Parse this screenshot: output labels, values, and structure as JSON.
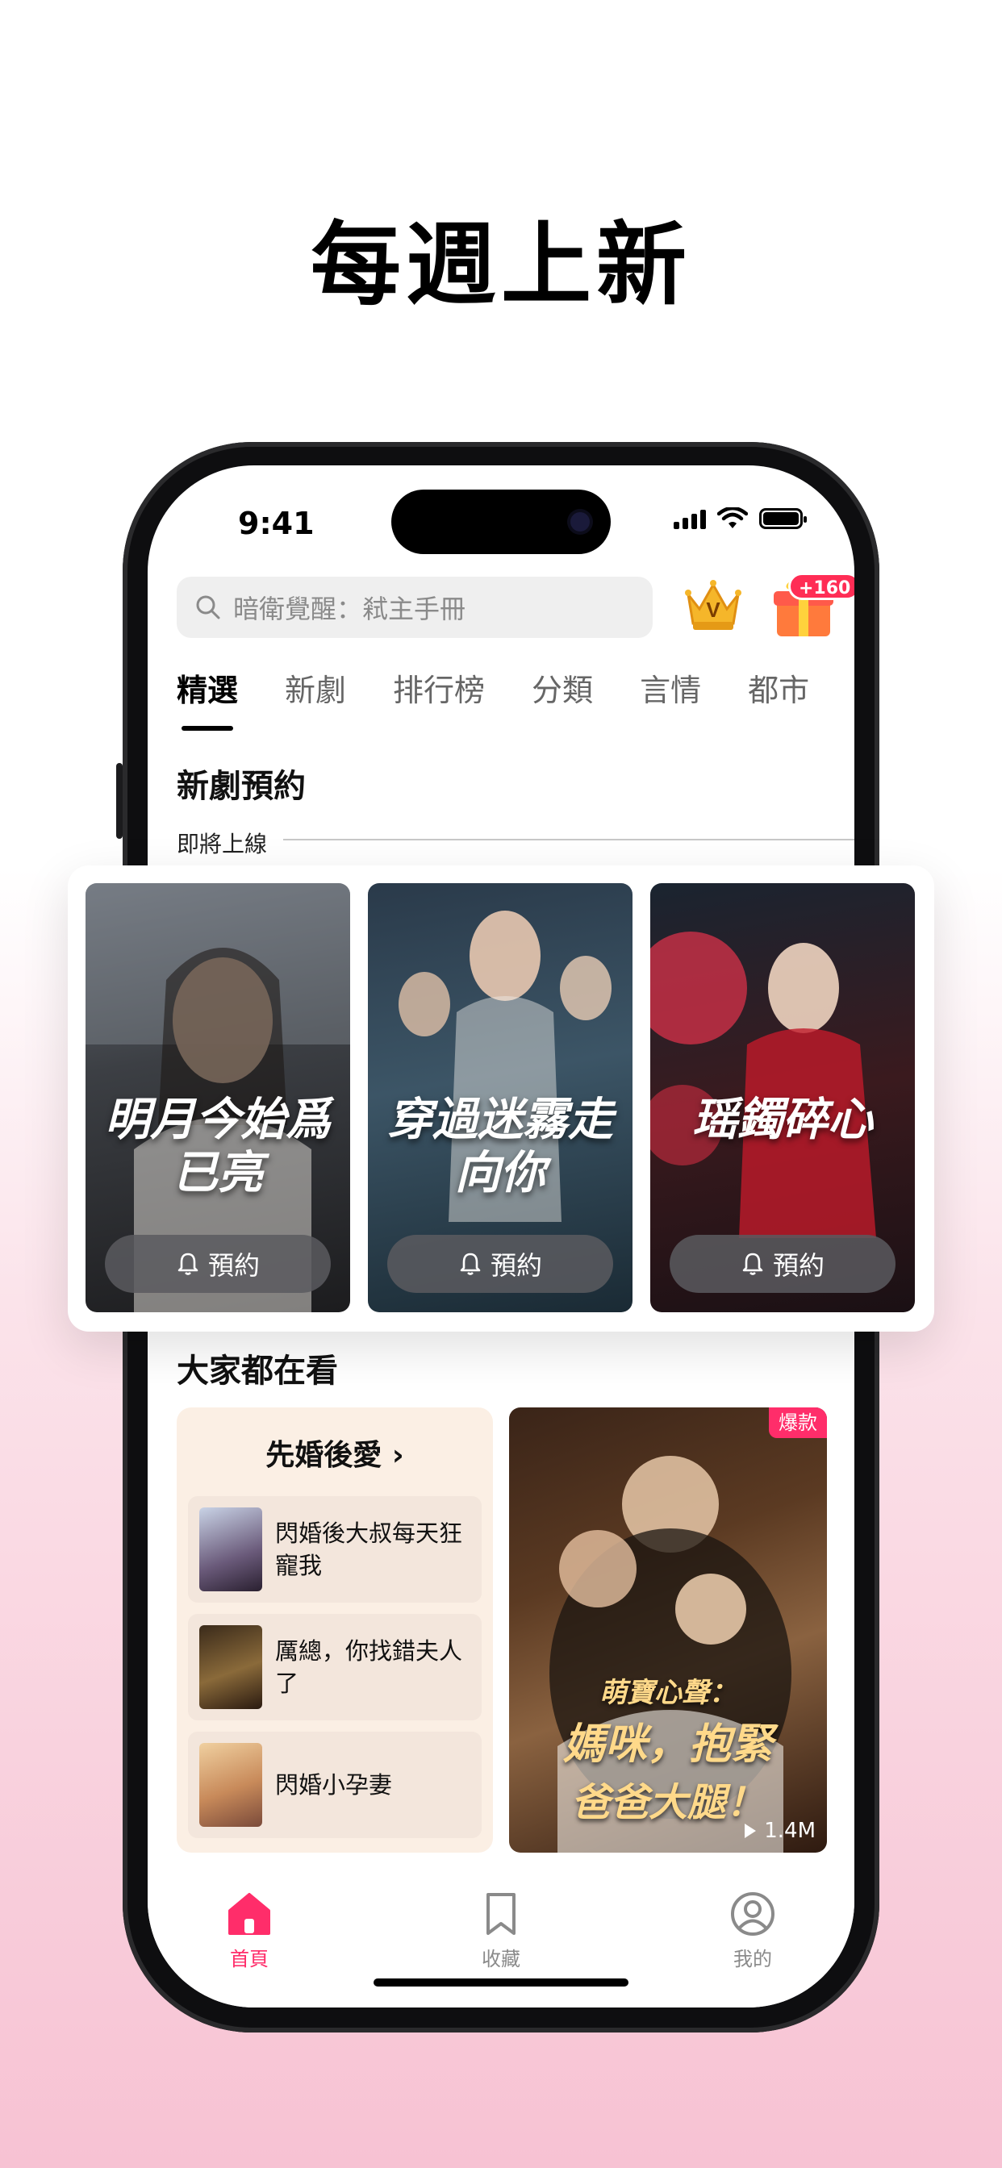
{
  "headline": "每週上新",
  "status": {
    "time": "9:41"
  },
  "search": {
    "placeholder": "暗衛覺醒：弒主手冊"
  },
  "gift": {
    "badge": "+160"
  },
  "tabs": [
    {
      "label": "精選",
      "active": true
    },
    {
      "label": "新劇"
    },
    {
      "label": "排行榜"
    },
    {
      "label": "分類"
    },
    {
      "label": "言情"
    },
    {
      "label": "都市"
    }
  ],
  "new_release": {
    "title": "新劇預約",
    "subtitle": "即將上線",
    "items": [
      {
        "title": "明月今始爲已亮",
        "button": "預約"
      },
      {
        "title": "穿過迷霧走向你",
        "button": "預約"
      },
      {
        "title": "瑶鐲碎心",
        "button": "預約"
      }
    ]
  },
  "popular": {
    "title": "大家都在看",
    "collection": {
      "title": "先婚後愛",
      "items": [
        {
          "name": "閃婚後大叔每天狂寵我"
        },
        {
          "name": "厲總，你找錯夫人了"
        },
        {
          "name": "閃婚小孕妻"
        }
      ]
    },
    "feature": {
      "badge": "爆款",
      "title_line1": "萌寶心聲：",
      "title_line2": "媽咪，抱緊",
      "title_line3": "爸爸大腿！",
      "views": "1.4M"
    }
  },
  "tabbar": [
    {
      "label": "首頁",
      "active": true
    },
    {
      "label": "收藏"
    },
    {
      "label": "我的"
    }
  ]
}
